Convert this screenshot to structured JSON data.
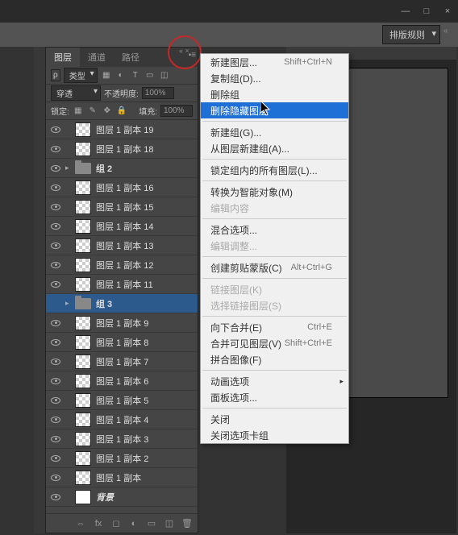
{
  "window": {
    "minimize": "—",
    "maximize": "□",
    "close": "×"
  },
  "toolbar": {
    "dropdown_label": "排版规则"
  },
  "panel": {
    "tabs": [
      "图层",
      "通道",
      "路径"
    ],
    "active_tab": 0,
    "type_label": "类型",
    "blend_mode": "穿透",
    "opacity_label": "不透明度:",
    "opacity_value": "100%",
    "lock_label": "锁定:",
    "fill_label": "填充:",
    "fill_value": "100%"
  },
  "layers": [
    {
      "name": "图层 1 副本 19",
      "type": "layer",
      "visible": true
    },
    {
      "name": "图层 1 副本 18",
      "type": "layer",
      "visible": true
    },
    {
      "name": "组 2",
      "type": "group",
      "visible": true
    },
    {
      "name": "图层 1 副本 16",
      "type": "layer",
      "visible": true
    },
    {
      "name": "图层 1 副本 15",
      "type": "layer",
      "visible": true
    },
    {
      "name": "图层 1 副本 14",
      "type": "layer",
      "visible": true
    },
    {
      "name": "图层 1 副本 13",
      "type": "layer",
      "visible": true
    },
    {
      "name": "图层 1 副本 12",
      "type": "layer",
      "visible": true
    },
    {
      "name": "图层 1 副本 11",
      "type": "layer",
      "visible": true
    },
    {
      "name": "组 3",
      "type": "group",
      "visible": false,
      "selected": true
    },
    {
      "name": "图层 1 副本 9",
      "type": "layer",
      "visible": true
    },
    {
      "name": "图层 1 副本 8",
      "type": "layer",
      "visible": true
    },
    {
      "name": "图层 1 副本 7",
      "type": "layer",
      "visible": true
    },
    {
      "name": "图层 1 副本 6",
      "type": "layer",
      "visible": true
    },
    {
      "name": "图层 1 副本 5",
      "type": "layer",
      "visible": true
    },
    {
      "name": "图层 1 副本 4",
      "type": "layer",
      "visible": true
    },
    {
      "name": "图层 1 副本 3",
      "type": "layer",
      "visible": true
    },
    {
      "name": "图层 1 副本 2",
      "type": "layer",
      "visible": true
    },
    {
      "name": "图层 1 副本",
      "type": "layer",
      "visible": true
    },
    {
      "name": "背景",
      "type": "bg",
      "visible": true
    }
  ],
  "menu": [
    {
      "label": "新建图层...",
      "shortcut": "Shift+Ctrl+N"
    },
    {
      "label": "复制组(D)..."
    },
    {
      "label": "删除组"
    },
    {
      "label": "删除隐藏图层",
      "highlighted": true
    },
    {
      "sep": true
    },
    {
      "label": "新建组(G)..."
    },
    {
      "label": "从图层新建组(A)..."
    },
    {
      "sep": true
    },
    {
      "label": "锁定组内的所有图层(L)..."
    },
    {
      "sep": true
    },
    {
      "label": "转换为智能对象(M)"
    },
    {
      "label": "编辑内容",
      "disabled": true
    },
    {
      "sep": true
    },
    {
      "label": "混合选项..."
    },
    {
      "label": "编辑调整...",
      "disabled": true
    },
    {
      "sep": true
    },
    {
      "label": "创建剪贴蒙版(C)",
      "shortcut": "Alt+Ctrl+G"
    },
    {
      "sep": true
    },
    {
      "label": "链接图层(K)",
      "disabled": true
    },
    {
      "label": "选择链接图层(S)",
      "disabled": true
    },
    {
      "sep": true
    },
    {
      "label": "向下合并(E)",
      "shortcut": "Ctrl+E"
    },
    {
      "label": "合并可见图层(V)",
      "shortcut": "Shift+Ctrl+E"
    },
    {
      "label": "拼合图像(F)"
    },
    {
      "sep": true
    },
    {
      "label": "动画选项",
      "submenu": true
    },
    {
      "label": "面板选项..."
    },
    {
      "sep": true
    },
    {
      "label": "关闭"
    },
    {
      "label": "关闭选项卡组"
    }
  ]
}
